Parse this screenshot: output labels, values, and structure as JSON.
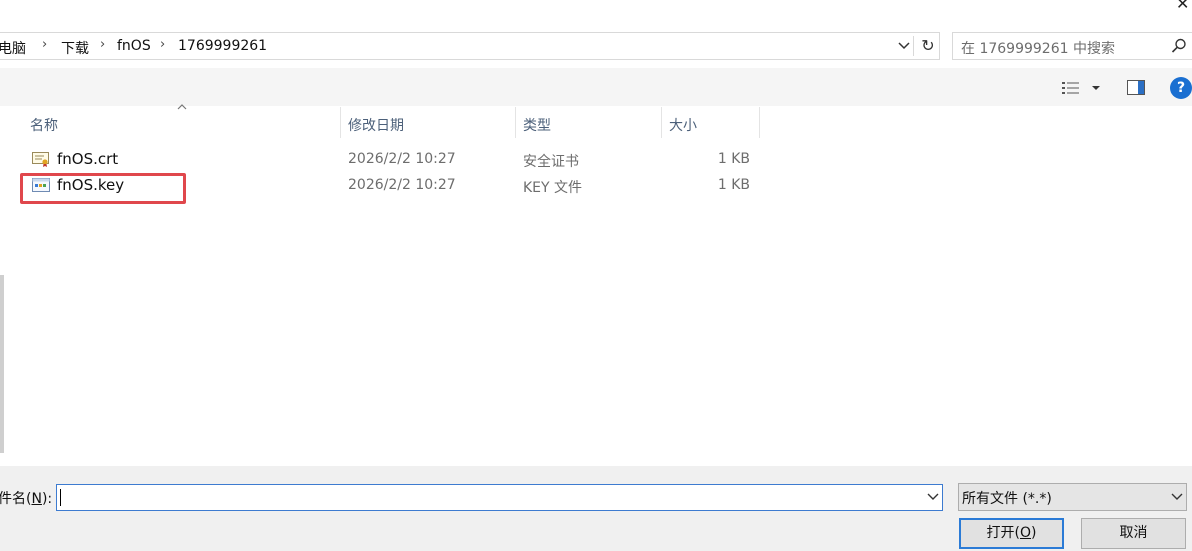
{
  "breadcrumb": {
    "items": [
      "此电脑",
      "下载",
      "fnOS",
      "1769999261"
    ]
  },
  "search": {
    "placeholder": "在 1769999261 中搜索"
  },
  "columns": {
    "name": "名称",
    "date": "修改日期",
    "type": "类型",
    "size": "大小"
  },
  "files": [
    {
      "name": "fnOS.crt",
      "date": "2026/2/2 10:27",
      "type": "安全证书",
      "size": "1 KB",
      "icon": "certificate-icon"
    },
    {
      "name": "fnOS.key",
      "date": "2026/2/2 10:27",
      "type": "KEY 文件",
      "size": "1 KB",
      "icon": "key-file-icon"
    }
  ],
  "bottom": {
    "filename_label_pre": "件名(",
    "filename_label_key": "N",
    "filename_label_post": "):",
    "filename_value": "",
    "filter_value": "所有文件 (*.*)",
    "open_pre": "打开(",
    "open_key": "O",
    "open_post": ")",
    "cancel_label": "取消"
  },
  "colors": {
    "highlight": "#e0474c",
    "accent": "#2b7bd6",
    "help": "#1a6fd1"
  }
}
